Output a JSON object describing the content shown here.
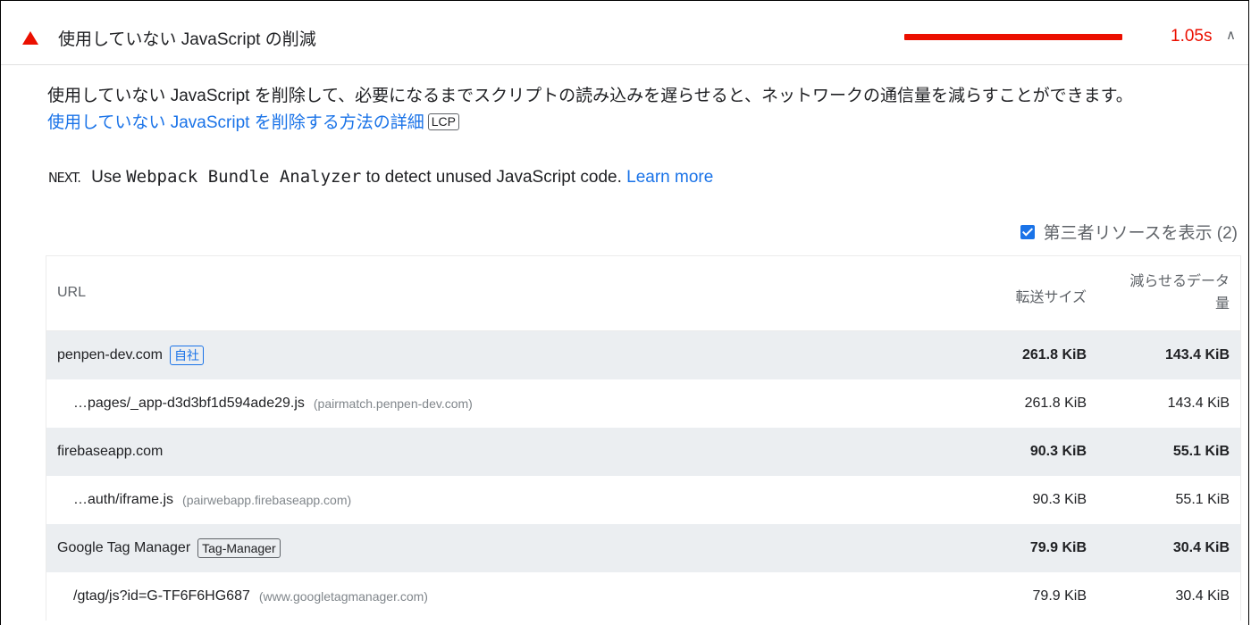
{
  "audit": {
    "title": "使用していない JavaScript の削減",
    "savings": "1.05s",
    "chevron": "^",
    "status_color": "#eb0f00"
  },
  "description": {
    "text": "使用していない JavaScript を削除して、必要になるまでスクリプトの読み込みを遅らせると、ネットワークの通信量を減らすことができます。",
    "link_text": "使用していない JavaScript を削除する方法の詳細",
    "badge": "LCP"
  },
  "stack_tip": {
    "logo": "NEXT.",
    "prefix": "Use",
    "code": "Webpack Bundle Analyzer",
    "suffix": "to detect unused JavaScript code.",
    "link": "Learn more"
  },
  "third_party": {
    "checked": true,
    "label": "第三者リソースを表示 (2)"
  },
  "table": {
    "headers": {
      "url": "URL",
      "size": "転送サイズ",
      "waste_line1": "減らせるデータ",
      "waste_line2": "量"
    },
    "rows": [
      {
        "kind": "group",
        "label": "penpen-dev.com",
        "badge": "自社",
        "size": "261.8 KiB",
        "waste": "143.4 KiB"
      },
      {
        "kind": "sub",
        "label": "…pages/_app-d3d3bf1d594ade29.js",
        "origin": "(pairmatch.penpen-dev.com)",
        "size": "261.8 KiB",
        "waste": "143.4 KiB"
      },
      {
        "kind": "group",
        "label": "firebaseapp.com",
        "size": "90.3 KiB",
        "waste": "55.1 KiB"
      },
      {
        "kind": "sub",
        "label": "…auth/iframe.js",
        "origin": "(pairwebapp.firebaseapp.com)",
        "size": "90.3 KiB",
        "waste": "55.1 KiB"
      },
      {
        "kind": "group",
        "label": "Google Tag Manager",
        "badge": "Tag-Manager",
        "size": "79.9 KiB",
        "waste": "30.4 KiB"
      },
      {
        "kind": "sub",
        "label": "/gtag/js?id=G-TF6F6HG687",
        "origin": "(www.googletagmanager.com)",
        "size": "79.9 KiB",
        "waste": "30.4 KiB"
      }
    ]
  },
  "colors": {
    "link": "#1a73e8",
    "fail": "#eb0f00",
    "group_row_bg": "#ebeef1"
  }
}
